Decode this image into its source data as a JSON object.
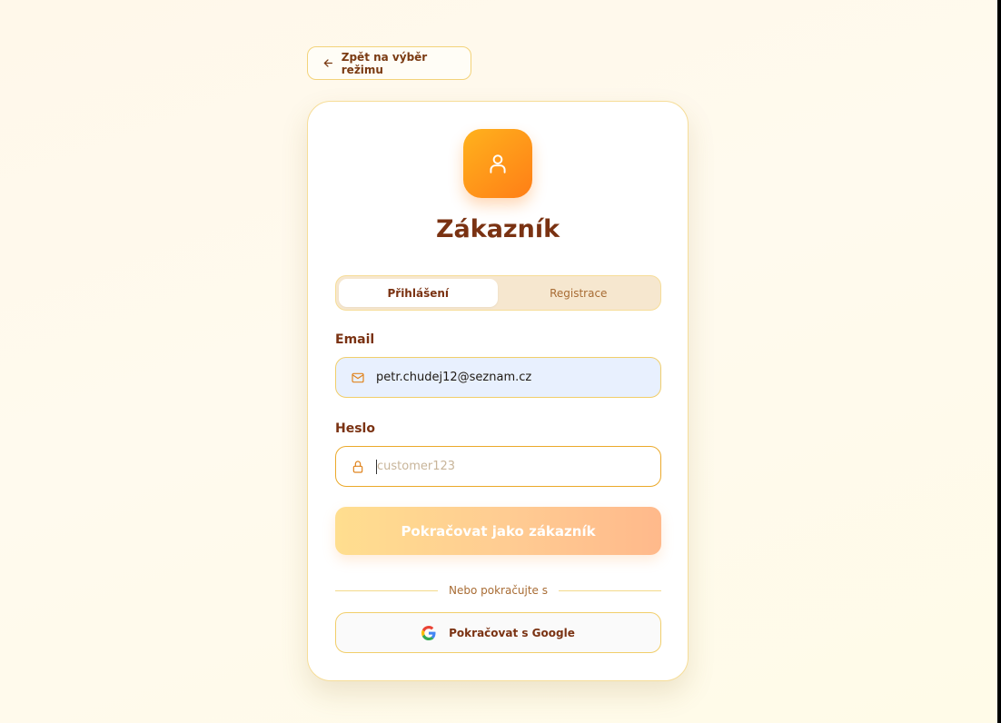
{
  "back_button": {
    "label": "Zpět na výběr režimu",
    "icon": "arrow-left-icon"
  },
  "card": {
    "avatar_icon": "user-icon",
    "title": "Zákazník",
    "tabs": [
      {
        "label": "Přihlášení",
        "active": true
      },
      {
        "label": "Registrace",
        "active": false
      }
    ],
    "email": {
      "label": "Email",
      "icon": "mail-icon",
      "value": "petr.chudej12@seznam.cz"
    },
    "password": {
      "label": "Heslo",
      "icon": "lock-icon",
      "placeholder": "customer123"
    },
    "submit_label": "Pokračovat jako zákazník",
    "divider_text": "Nebo pokračujte s",
    "google_button": {
      "label": "Pokračovat s Google",
      "icon": "google-icon"
    }
  },
  "colors": {
    "accent": "#ff9a1a",
    "title": "#7a3212",
    "border": "#f6dd98",
    "email_fill": "#e8f0fe"
  }
}
